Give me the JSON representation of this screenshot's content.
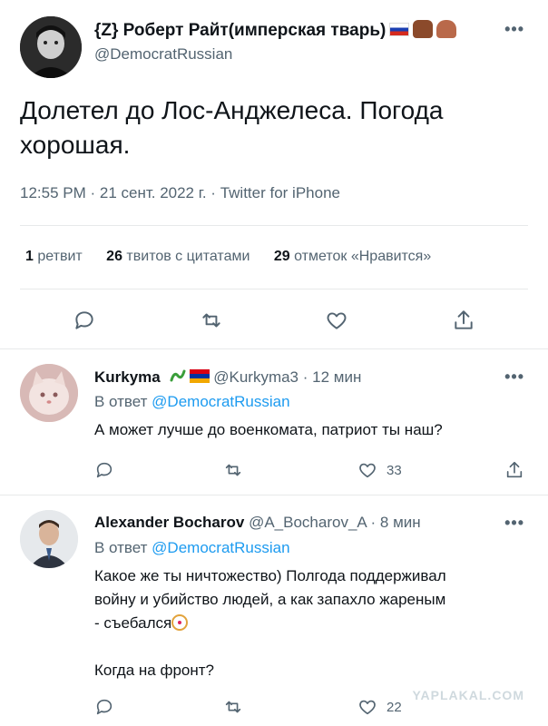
{
  "main_tweet": {
    "author_name": "{Z} Роберт Райт(имперская тварь)",
    "author_handle": "@DemocratRussian",
    "text_line1": "Долетел до Лос-Анджелеса. Погода",
    "text_line2": "хорошая.",
    "meta": "12:55 PM · 21 сент. 2022 г. · Twitter for iPhone",
    "stats": {
      "retweets_count": "1",
      "retweets_label": "ретвит",
      "quotes_count": "26",
      "quotes_label": "твитов с цитатами",
      "likes_count": "29",
      "likes_label": "отметок «Нравится»"
    }
  },
  "replies": [
    {
      "author_name": "Kurkyma",
      "author_handle": "@Kurkyma3",
      "time": "· 12 мин",
      "reply_to_prefix": "В ответ ",
      "reply_to_mention": "@DemocratRussian",
      "text_lines": [
        "А может лучше до военкомата, патриот ты наш?"
      ],
      "likes": "33"
    },
    {
      "author_name": "Alexander Bocharov",
      "author_handle": "@A_Bocharov_A",
      "time": "· 8 мин",
      "reply_to_prefix": "В ответ ",
      "reply_to_mention": "@DemocratRussian",
      "text_lines": [
        "Какое же ты ничтожество) Полгода поддерживал",
        "войну и убийство людей, а как запахло жареным",
        "- съебался",
        "Когда на фронт?"
      ],
      "likes": "22"
    }
  ],
  "watermark": "YAPLAKAL.COM",
  "icons": [
    "reply-icon",
    "retweet-icon",
    "like-icon",
    "share-icon",
    "more-icon"
  ]
}
